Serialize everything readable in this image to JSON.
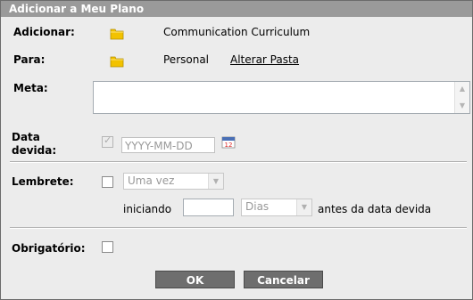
{
  "dialog": {
    "title": "Adicionar a Meu Plano"
  },
  "form": {
    "add_label": "Adicionar:",
    "add_value": "Communication Curriculum",
    "for_label": "Para:",
    "for_value": "Personal",
    "change_folder_link": "Alterar Pasta",
    "goal_label": "Meta:",
    "goal_value": "",
    "due_label_line1": "Data",
    "due_label_line2": "devida:",
    "due_checked": true,
    "due_placeholder": "YYYY-MM-DD",
    "reminder_label": "Lembrete:",
    "reminder_checked": false,
    "reminder_frequency": "Uma vez",
    "starting_label": "iniciando",
    "starting_value": "",
    "unit_value": "Dias",
    "before_due_text": "antes da data devida",
    "required_label": "Obrigatório:",
    "required_checked": false
  },
  "buttons": {
    "ok": "OK",
    "cancel": "Cancelar"
  },
  "icons": {
    "folder": "folder-icon",
    "calendar": "calendar-icon",
    "calendar_day": "12"
  },
  "colors": {
    "titlebar": "#9a9a9a",
    "dialog_bg": "#ececec",
    "button_bg": "#6e6e6e",
    "folder": "#f2c200"
  }
}
